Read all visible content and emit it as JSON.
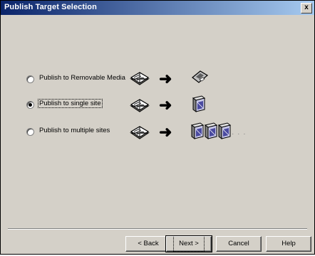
{
  "window": {
    "title": "Publish Target Selection",
    "close_label": "x"
  },
  "options": [
    {
      "label": "Publish to Removable Media",
      "checked": false,
      "icons": [
        "book-icon",
        "arrow-right-icon",
        "floppy-disk-icon"
      ]
    },
    {
      "label": "Publish to single site",
      "checked": true,
      "icons": [
        "book-icon",
        "arrow-right-icon",
        "server-icon"
      ]
    },
    {
      "label": "Publish to multiple sites",
      "checked": false,
      "icons": [
        "book-icon",
        "arrow-right-icon",
        "server-icon",
        "server-icon",
        "server-icon"
      ],
      "ellipsis": "· · ·"
    }
  ],
  "arrow": "➜",
  "buttons": {
    "back": "< Back",
    "next": "Next >",
    "cancel": "Cancel",
    "help": "Help"
  },
  "colors": {
    "title_gradient_start": "#0a246a",
    "title_gradient_end": "#a6caf0",
    "dialog_bg": "#d4d0c8"
  }
}
